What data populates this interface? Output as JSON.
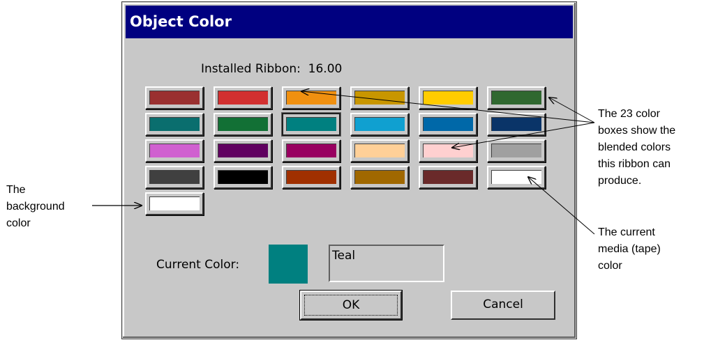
{
  "dialog": {
    "title": "Object Color",
    "ribbon_label": "Installed Ribbon:  16.00",
    "swatches": [
      {
        "color": "#9a3030"
      },
      {
        "color": "#d23030"
      },
      {
        "color": "#f09010"
      },
      {
        "color": "#c89600"
      },
      {
        "color": "#ffcc00"
      },
      {
        "color": "#306830"
      },
      {
        "color": "#0a6e6e"
      },
      {
        "color": "#127035"
      },
      {
        "color": "#008080"
      },
      {
        "color": "#10a0d0"
      },
      {
        "color": "#0068a8"
      },
      {
        "color": "#0a3468"
      },
      {
        "color": "#d060d0"
      },
      {
        "color": "#600060"
      },
      {
        "color": "#980060"
      },
      {
        "color": "#ffd098"
      },
      {
        "color": "#ffd0d0"
      },
      {
        "color": "#a0a0a0"
      },
      {
        "color": "#404040"
      },
      {
        "color": "#000000"
      },
      {
        "color": "#a03000"
      },
      {
        "color": "#a06800"
      },
      {
        "color": "#6a2a2a"
      },
      {
        "color": "#ffffff"
      },
      {
        "color": "#ffffff"
      }
    ],
    "selected_index": 8,
    "current_color_label": "Current Color:",
    "current_color_value": "Teal",
    "current_color_hex": "#008080",
    "ok_label": "OK",
    "cancel_label": "Cancel"
  },
  "annotations": {
    "background": [
      "The",
      "background",
      "color"
    ],
    "color_boxes": [
      "The 23 color",
      "boxes show the",
      "blended colors",
      "this ribbon can",
      "produce."
    ],
    "media": [
      "The current",
      "media (tape)",
      "color"
    ]
  }
}
